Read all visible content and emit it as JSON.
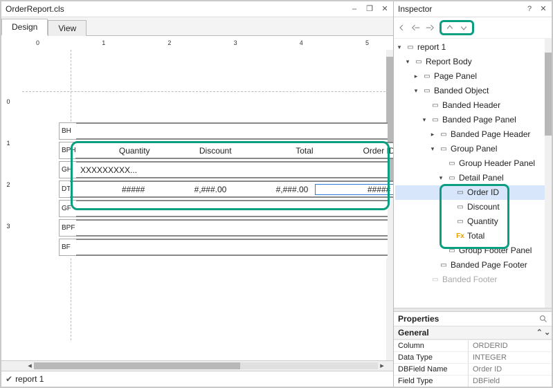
{
  "document_title": "OrderReport.cls",
  "tabs": {
    "design": "Design",
    "view": "View"
  },
  "ruler_top": [
    "0",
    "1",
    "2",
    "3",
    "4",
    "5"
  ],
  "ruler_left": [
    "0",
    "1",
    "2",
    "3"
  ],
  "bands": {
    "BH": "BH",
    "BPH": "BPH",
    "GH": "GH",
    "DT": "DT",
    "GF": "GF",
    "BPF": "BPF",
    "BF": "BF"
  },
  "columns": {
    "quantity": "Quantity",
    "discount": "Discount",
    "total": "Total",
    "orderid": "Order ID"
  },
  "gh_text": "XXXXXXXXX...",
  "dt_cells": {
    "quantity": "#####",
    "discount": "#,###.00",
    "total": "#,###.00",
    "orderid": "#####"
  },
  "footer_tab": "report 1",
  "inspector": {
    "title": "Inspector",
    "properties_title": "Properties",
    "group": "General",
    "tree": {
      "root": "report 1",
      "report_body": "Report Body",
      "page_panel": "Page Panel",
      "banded_object": "Banded Object",
      "banded_header": "Banded Header",
      "banded_page_panel": "Banded Page Panel",
      "banded_page_header": "Banded Page Header",
      "group_panel": "Group Panel",
      "group_header_panel": "Group Header Panel",
      "detail_panel": "Detail Panel",
      "field_orderid": "Order ID",
      "field_discount": "Discount",
      "field_quantity": "Quantity",
      "field_total": "Total",
      "group_footer_panel": "Group Footer Panel",
      "banded_page_footer": "Banded Page Footer",
      "banded_footer": "Banded Footer"
    },
    "properties": {
      "Column": "ORDERID",
      "Data Type": "INTEGER",
      "DBField Name": "Order ID",
      "Field Type": "DBField"
    }
  }
}
